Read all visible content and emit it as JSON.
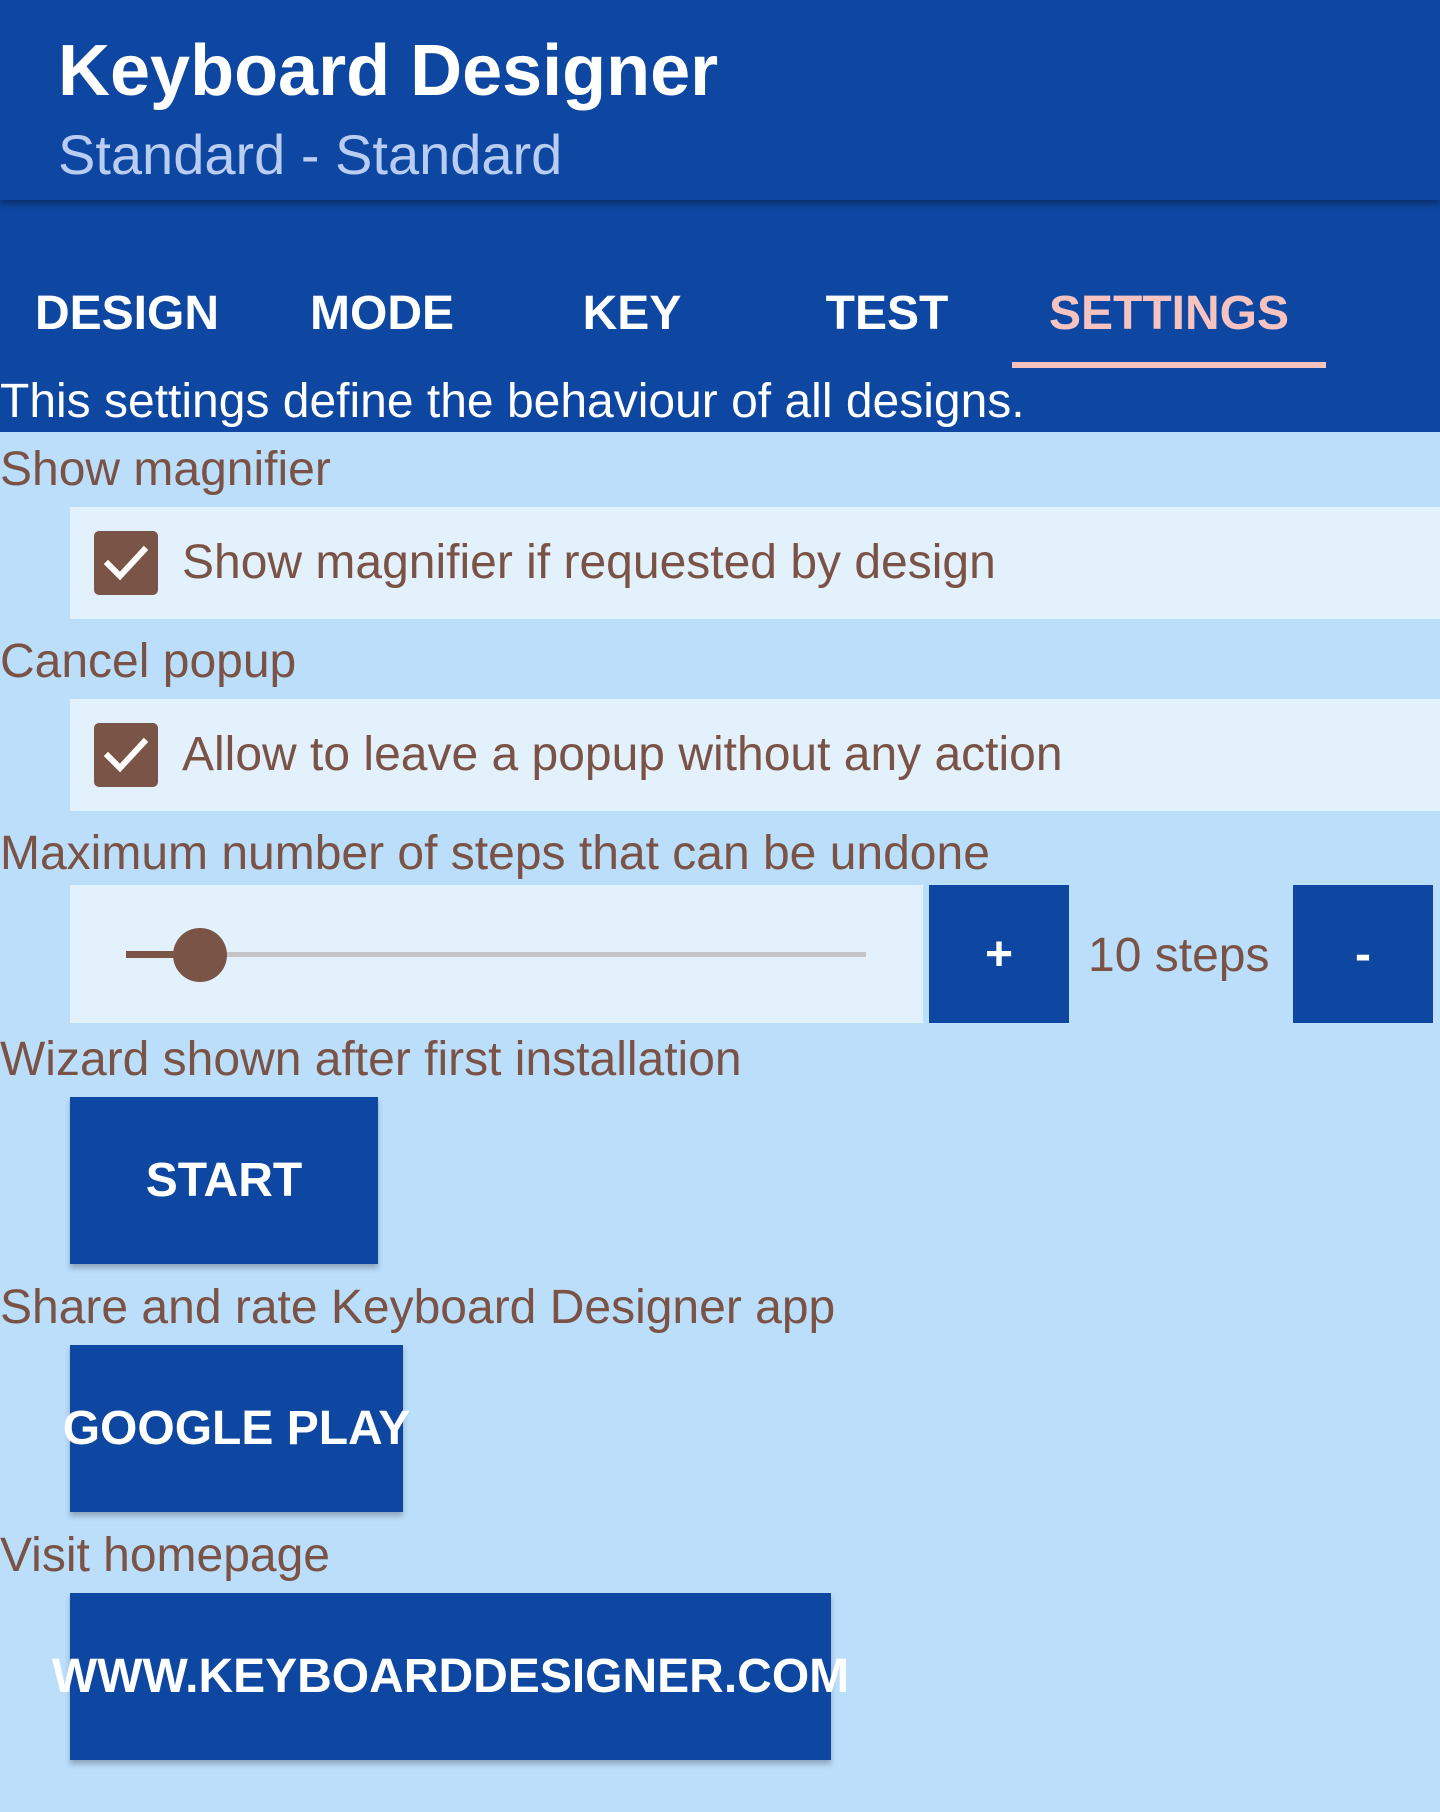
{
  "app": {
    "title": "Keyboard Designer",
    "subtitle": "Standard - Standard"
  },
  "tabs": [
    {
      "label": "DESIGN"
    },
    {
      "label": "MODE"
    },
    {
      "label": "KEY"
    },
    {
      "label": "TEST"
    },
    {
      "label": "SETTINGS",
      "active": true
    }
  ],
  "intro": "This settings define the behaviour of all designs.",
  "settings": {
    "magnifier": {
      "label": "Show magnifier",
      "checkbox_label": "Show magnifier if requested by design",
      "checked": true
    },
    "cancel_popup": {
      "label": "Cancel popup",
      "checkbox_label": "Allow to leave a popup without any action",
      "checked": true
    },
    "undo": {
      "label": "Maximum number of steps that can be undone",
      "slider_fraction": 0.1,
      "increase_label": "+",
      "decrease_label": "-",
      "value_text": "10 steps"
    },
    "wizard": {
      "label": "Wizard shown after first installation",
      "button": "START"
    },
    "share": {
      "label": "Share and rate Keyboard Designer app",
      "button": "GOOGLE PLAY"
    },
    "homepage": {
      "label": "Visit homepage",
      "button": "WWW.KEYBOARDDESIGNER.COM"
    }
  },
  "colors": {
    "primary": "#0e47a1",
    "background": "#bbdefa",
    "row_background": "#e3f1fc",
    "accent_text": "#7b5346",
    "active_tab": "#f7c3c0"
  }
}
